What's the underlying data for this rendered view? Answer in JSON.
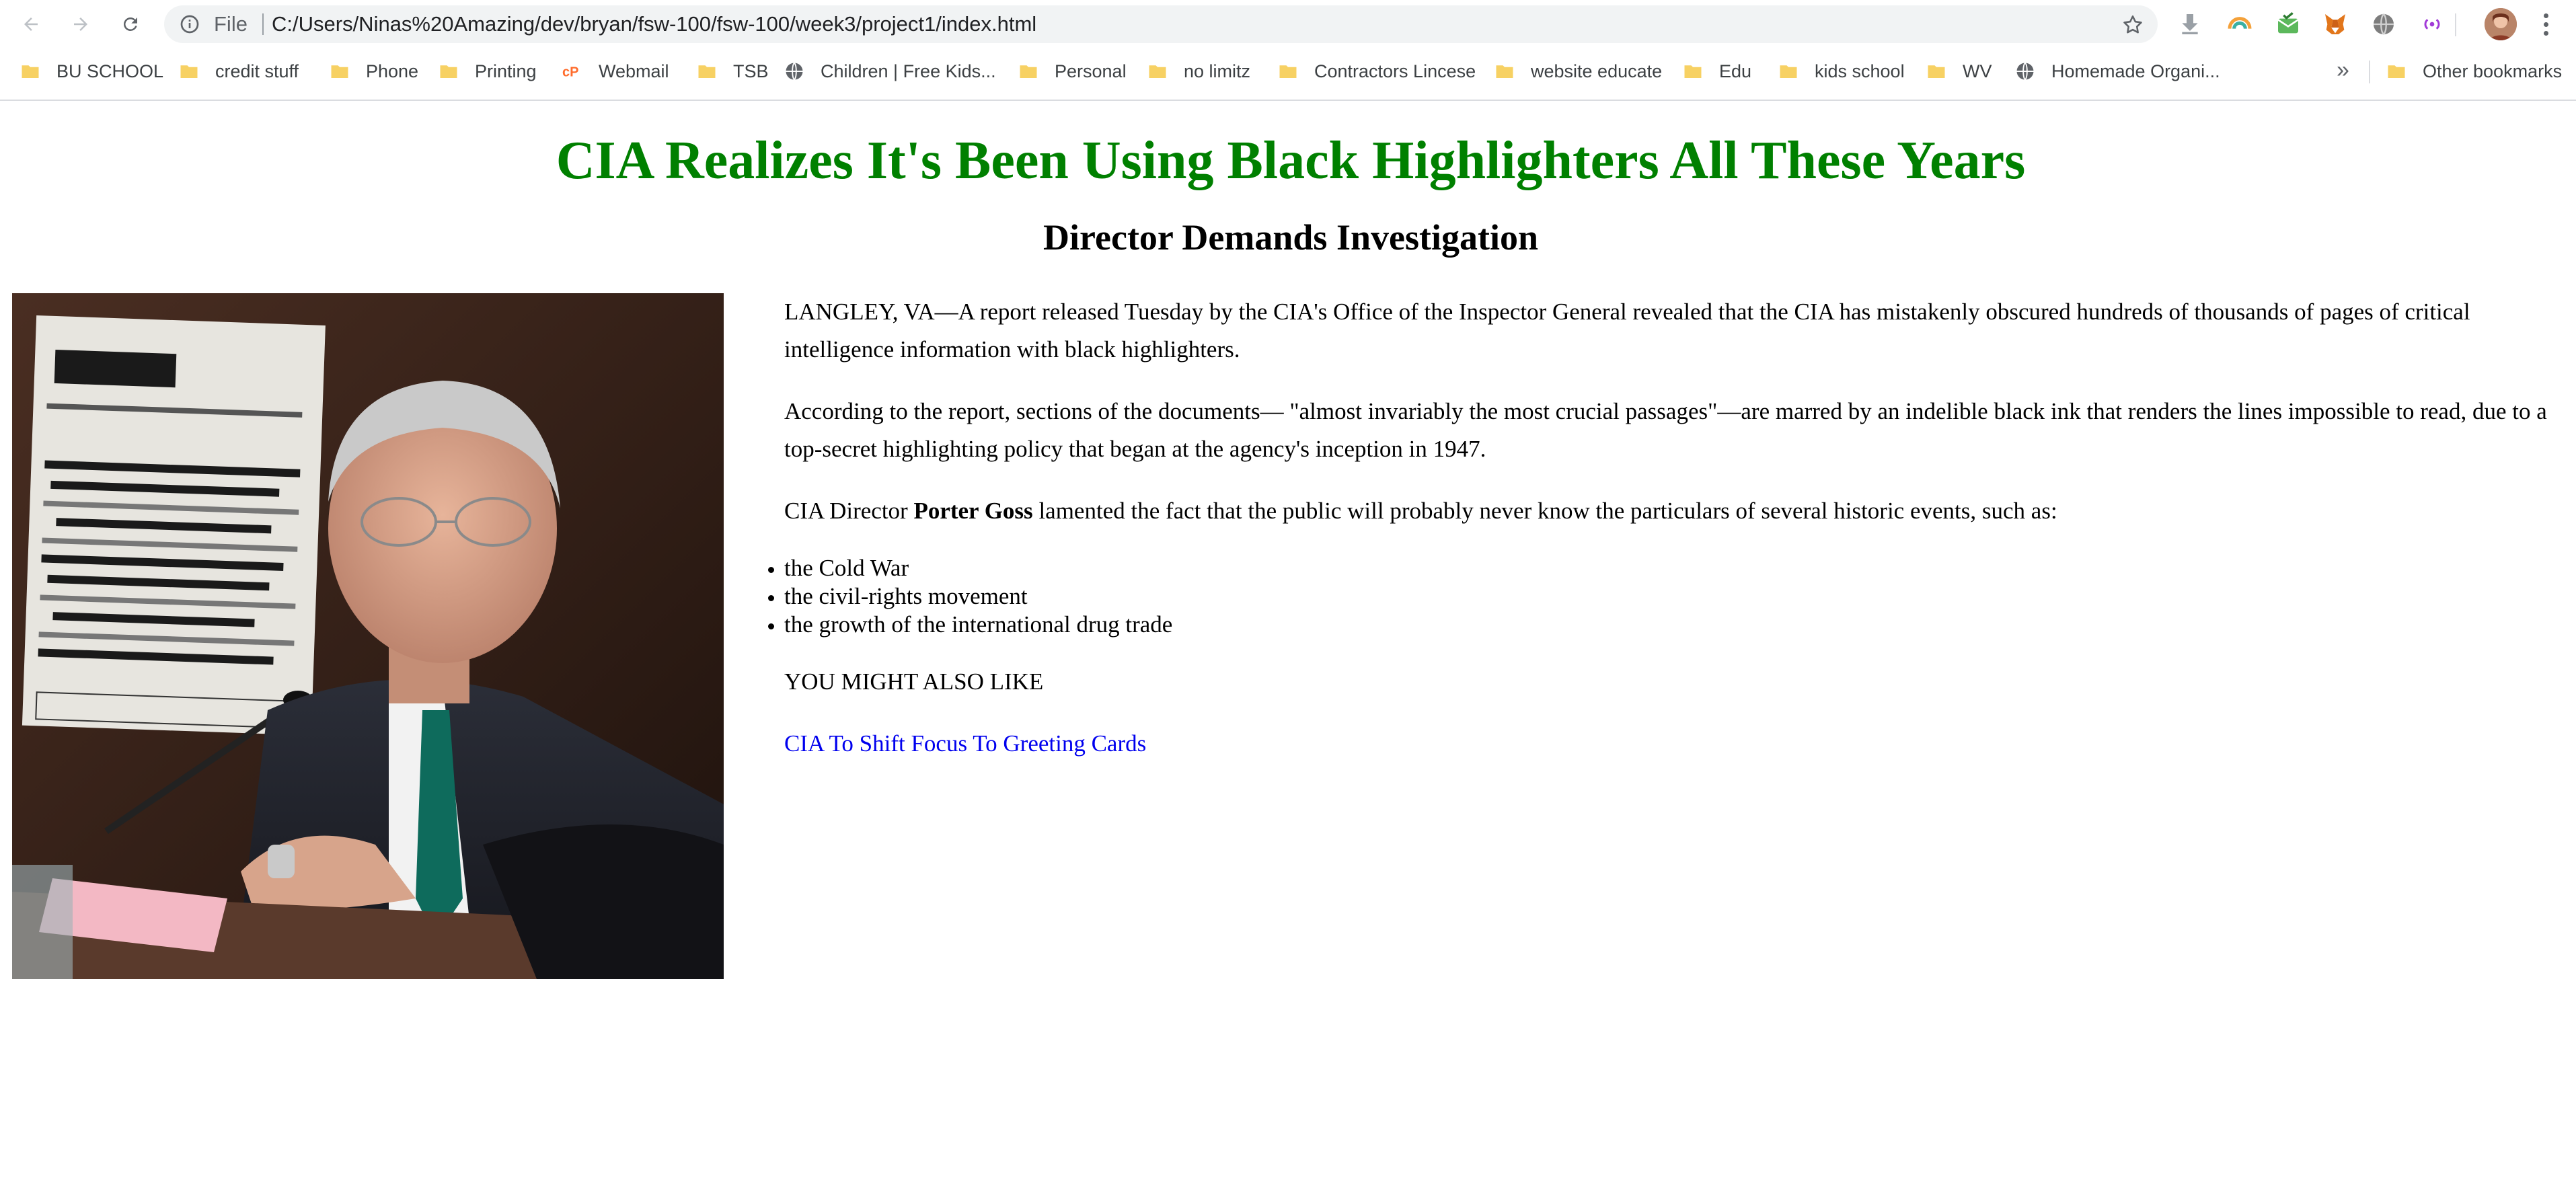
{
  "browser": {
    "omnibox": {
      "scheme_label": "File",
      "url": "C:/Users/Ninas%20Amazing/dev/bryan/fsw-100/fsw-100/week3/project1/index.html"
    },
    "nav_icons": [
      "back-icon",
      "forward-icon",
      "reload-icon"
    ],
    "extensions": [
      "download-icon",
      "rainbow-extension-icon",
      "mail-check-extension-icon",
      "metamask-fox-icon",
      "globe-extension-icon",
      "broadcast-extension-icon"
    ],
    "bookmarks": [
      {
        "label": "BU SCHOOL",
        "icon": "folder-icon"
      },
      {
        "label": "credit stuff",
        "icon": "folder-icon"
      },
      {
        "label": "Phone",
        "icon": "folder-icon"
      },
      {
        "label": "Printing",
        "icon": "folder-icon"
      },
      {
        "label": "Webmail",
        "icon": "cpanel-icon"
      },
      {
        "label": "TSB",
        "icon": "folder-icon"
      },
      {
        "label": "Children | Free Kids...",
        "icon": "globe-icon"
      },
      {
        "label": "Personal",
        "icon": "folder-icon"
      },
      {
        "label": "no limitz",
        "icon": "folder-icon"
      },
      {
        "label": "Contractors Lincese",
        "icon": "folder-icon"
      },
      {
        "label": "website educate",
        "icon": "folder-icon"
      },
      {
        "label": "Edu",
        "icon": "folder-icon"
      },
      {
        "label": "kids school",
        "icon": "folder-icon"
      },
      {
        "label": "WV",
        "icon": "folder-icon"
      },
      {
        "label": "Homemade Organi...",
        "icon": "globe-icon"
      }
    ],
    "bookmarks_overflow": "»",
    "other_bookmarks": "Other bookmarks"
  },
  "colors": {
    "headline": "#008000",
    "link": "#0000ee",
    "folder": "#f7d163"
  },
  "article": {
    "headline": "CIA Realizes It's Been Using Black Highlighters All These Years",
    "subhead": "Director Demands Investigation",
    "paragraph_1": "LANGLEY, VA—A report released Tuesday by the CIA's Office of the Inspector General revealed that the CIA has mistakenly obscured hundreds of thousands of pages of critical intelligence information with black highlighters.",
    "paragraph_2": "According to the report, sections of the documents— \"almost invariably the most crucial passages\"—are marred by an indelible black ink that renders the lines impossible to read, due to a top-secret highlighting policy that began at the agency's inception in 1947.",
    "paragraph_3": {
      "before": "CIA Director ",
      "bold": "Porter Goss",
      "after": " lamented the fact that the public will probably never know the particulars of several historic events, such as:"
    },
    "events": [
      "the Cold War",
      "the civil-rights movement",
      "the growth of the international drug trade"
    ],
    "also_like_heading": "YOU MIGHT ALSO LIKE",
    "also_like_link": "CIA To Shift Focus To Greeting Cards"
  }
}
